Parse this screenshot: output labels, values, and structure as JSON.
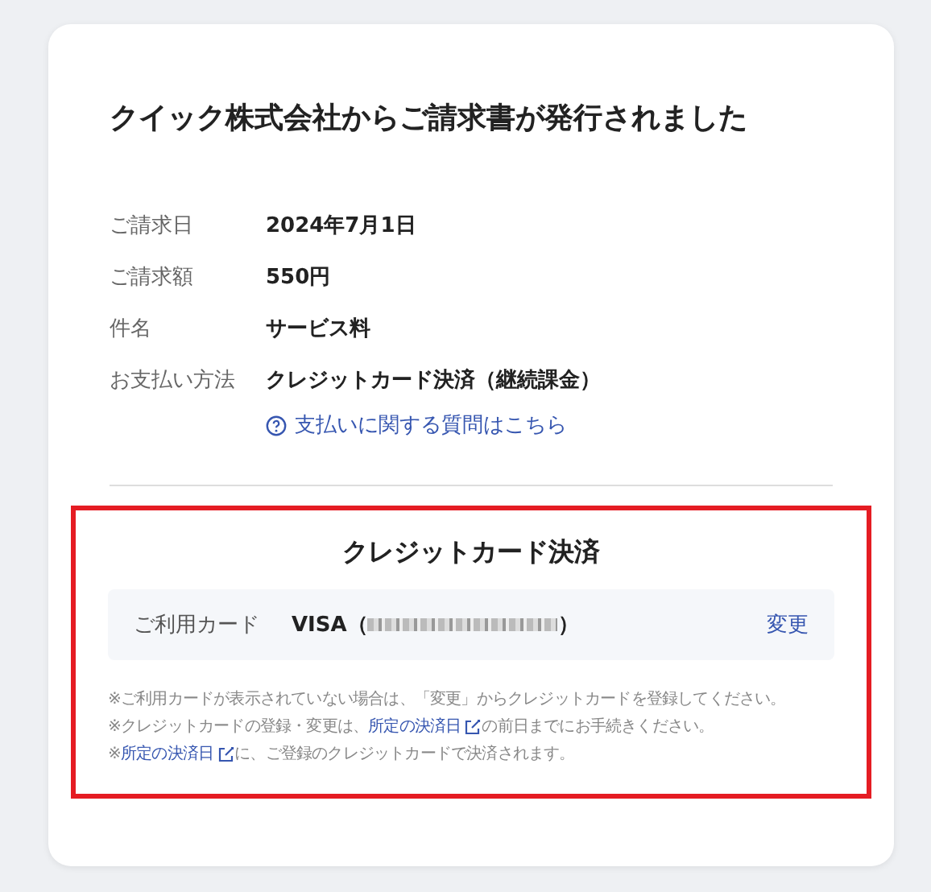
{
  "title": "クイック株式会社からご請求書が発行されました",
  "details": [
    {
      "label": "ご請求日",
      "value": "2024年7月1日"
    },
    {
      "label": "ご請求額",
      "value": "550円"
    },
    {
      "label": "件名",
      "value": "サービス料"
    },
    {
      "label": "お支払い方法",
      "value": "クレジットカード決済（継続課金）"
    }
  ],
  "help_link": "支払いに関する質問はこちら",
  "payment": {
    "heading": "クレジットカード決済",
    "card_label": "ご利用カード",
    "card_prefix": "VISA（",
    "card_suffix": "）",
    "change": "変更",
    "notes": [
      {
        "before": "※ご利用カードが表示されていない場合は、「変更」からクレジットカードを登録してください。"
      },
      {
        "before": "※クレジットカードの登録・変更は、",
        "link": "所定の決済日",
        "after": "の前日までにお手続きください。"
      },
      {
        "before": "※",
        "link": "所定の決済日",
        "after": "に、ご登録のクレジットカードで決済されます。"
      }
    ]
  }
}
